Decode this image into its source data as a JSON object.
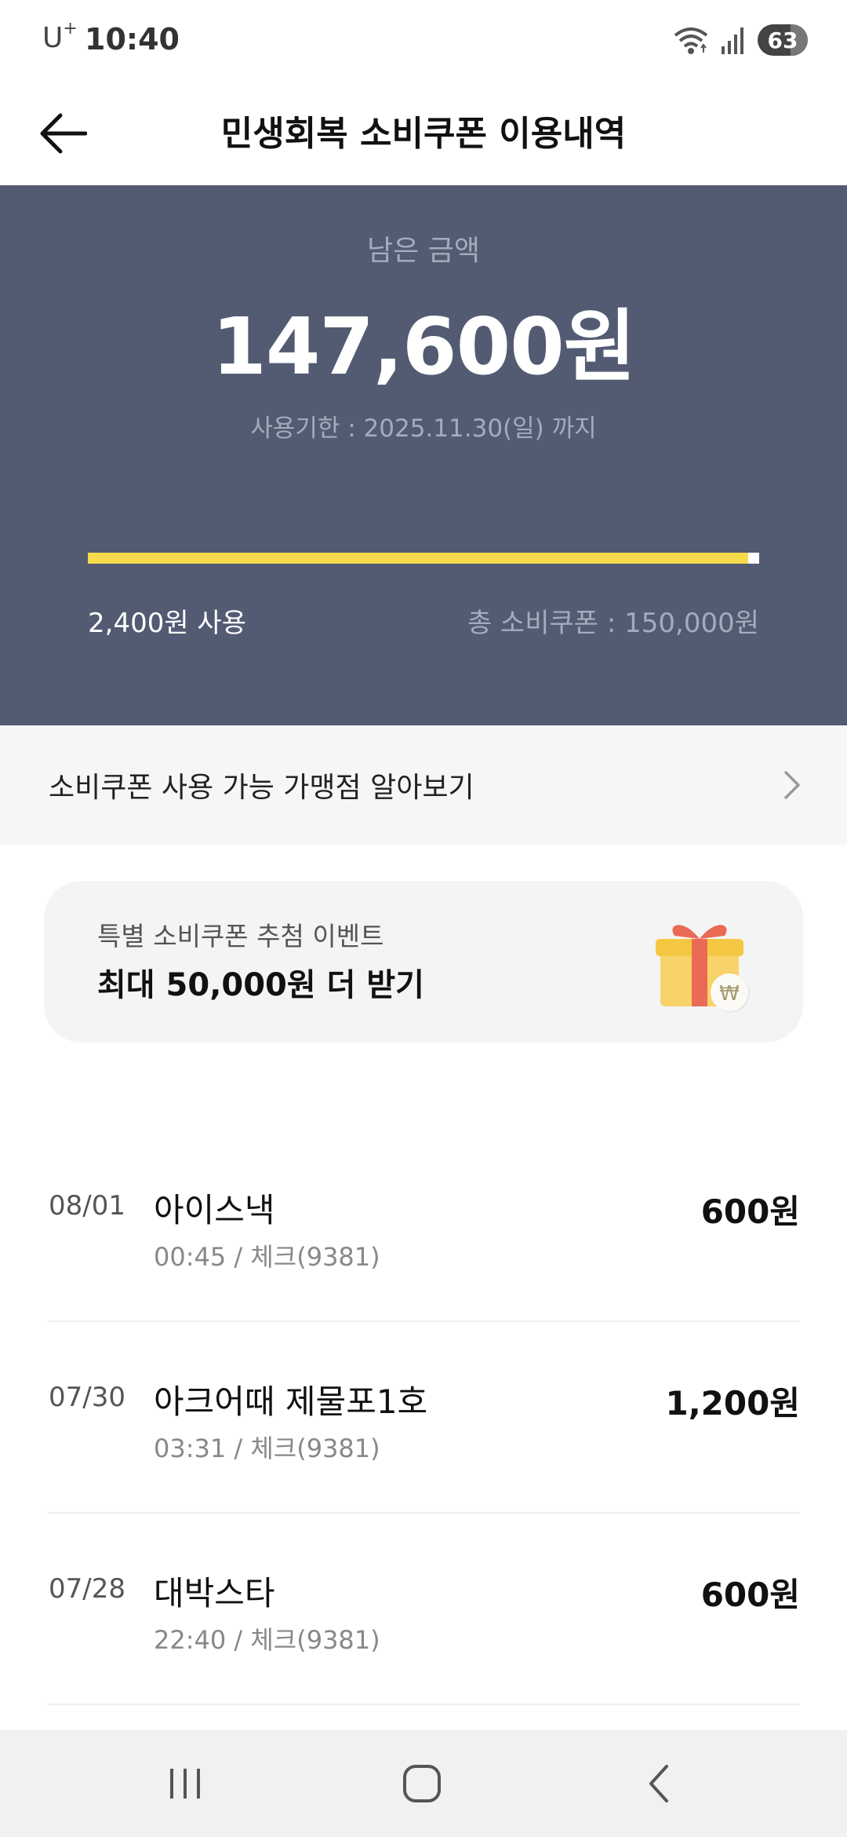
{
  "status_bar": {
    "carrier": "U",
    "carrier_sup": "+",
    "time": "10:40",
    "battery": "63"
  },
  "header": {
    "title": "민생회복 소비쿠폰 이용내역",
    "back_icon": "arrow-left-icon"
  },
  "summary": {
    "remain_label": "남은 금액",
    "remain_amount": "147,600원",
    "expire_text": "사용기한 : 2025.11.30(일) 까지",
    "used_text": "2,400원 사용",
    "total_text": "총 소비쿠폰 : 150,000원",
    "used_fraction": 0.016,
    "colors": {
      "panel": "#525b72",
      "progress": "#f5db4b",
      "track": "#ffffff"
    }
  },
  "merchant_link": {
    "label": "소비쿠폰 사용 가능 가맹점 알아보기",
    "icon": "chevron-right-icon"
  },
  "event": {
    "subtitle": "특별 소비쿠폰 추첨 이벤트",
    "title": "최대 50,000원 더 받기",
    "icon": "gift-icon",
    "badge_symbol": "₩"
  },
  "transactions": [
    {
      "date": "08/01",
      "name": "아이스낵",
      "meta": "00:45 / 체크(9381)",
      "amount": "600원"
    },
    {
      "date": "07/30",
      "name": "아크어때 제물포1호",
      "meta": "03:31 / 체크(9381)",
      "amount": "1,200원"
    },
    {
      "date": "07/28",
      "name": "대박스타",
      "meta": "22:40 / 체크(9381)",
      "amount": "600원"
    }
  ],
  "navbar": {
    "recents_icon": "recent-apps-icon",
    "home_icon": "home-icon",
    "back_icon": "nav-back-icon"
  }
}
